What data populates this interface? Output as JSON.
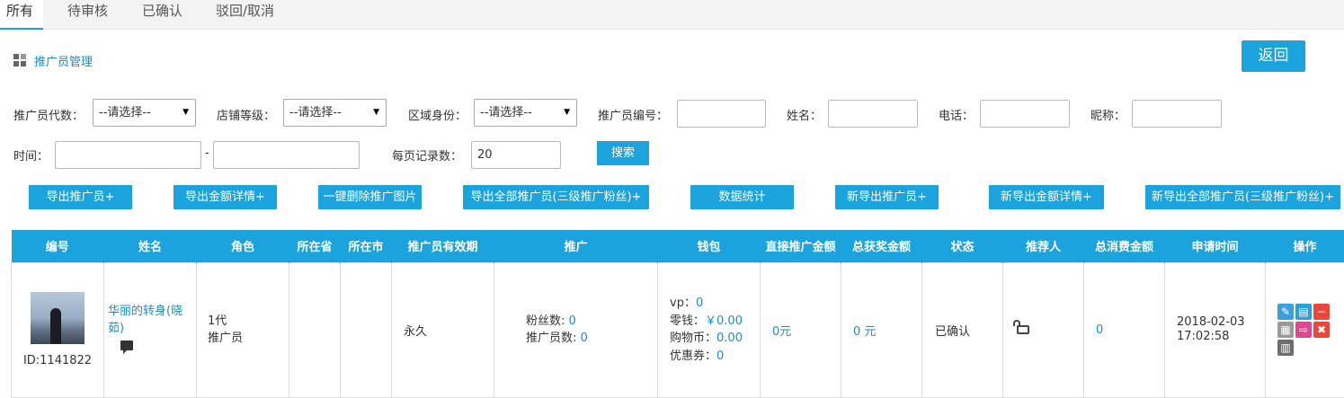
{
  "tabs": [
    "所有",
    "待审核",
    "已确认",
    "驳回/取消"
  ],
  "breadcrumb": "推广员管理",
  "return_label": "返回",
  "filters": {
    "level_label": "推广员代数：",
    "level_value": "--请选择--",
    "store_label": "店铺等级：",
    "store_value": "--请选择--",
    "region_label": "区域身份：",
    "region_value": "--请选择--",
    "id_label": "推广员编号：",
    "name_label": "姓名：",
    "phone_label": "电话：",
    "nick_label": "昵称：",
    "time_label": "时间：",
    "time_sep": "-",
    "perpage_label": "每页记录数：",
    "perpage_value": "20",
    "search_label": "搜索"
  },
  "actions": [
    "导出推广员+",
    "导出金额详情+",
    "一键删除推广图片",
    "导出全部推广员(三级推广粉丝)+",
    "数据统计",
    "新导出推广员+",
    "新导出金额详情+",
    "新导出全部推广员(三级推广粉丝)+"
  ],
  "table": {
    "headers": [
      "编号",
      "姓名",
      "角色",
      "所在省",
      "所在市",
      "推广员有效期",
      "推广",
      "钱包",
      "直接推广金额",
      "总获奖金额",
      "状态",
      "推荐人",
      "总消费金额",
      "申请时间",
      "操作"
    ],
    "row": {
      "id": "ID:1141822",
      "name": "华丽的转身(晓茹)",
      "role_level": "1代",
      "role_name": "推广员",
      "validity": "永久",
      "fans_label": "粉丝数:",
      "fans_value": "0",
      "promoters_label": "推广员数:",
      "promoters_value": "0",
      "vp_label": "vp：",
      "vp_value": "0",
      "change_label": "零钱：",
      "change_value": "￥0.00",
      "coin_label": "购物币：",
      "coin_value": "0.00",
      "coupon_label": "优惠券：",
      "coupon_value": "0",
      "direct_amount": "0元",
      "total_award": "0 元",
      "status": "已确认",
      "total_spend": "0",
      "apply_date": "2018-02-03",
      "apply_time": "17:02:58"
    }
  },
  "colors": {
    "accent": "#1aa3dc",
    "link": "#1a8fc9"
  }
}
